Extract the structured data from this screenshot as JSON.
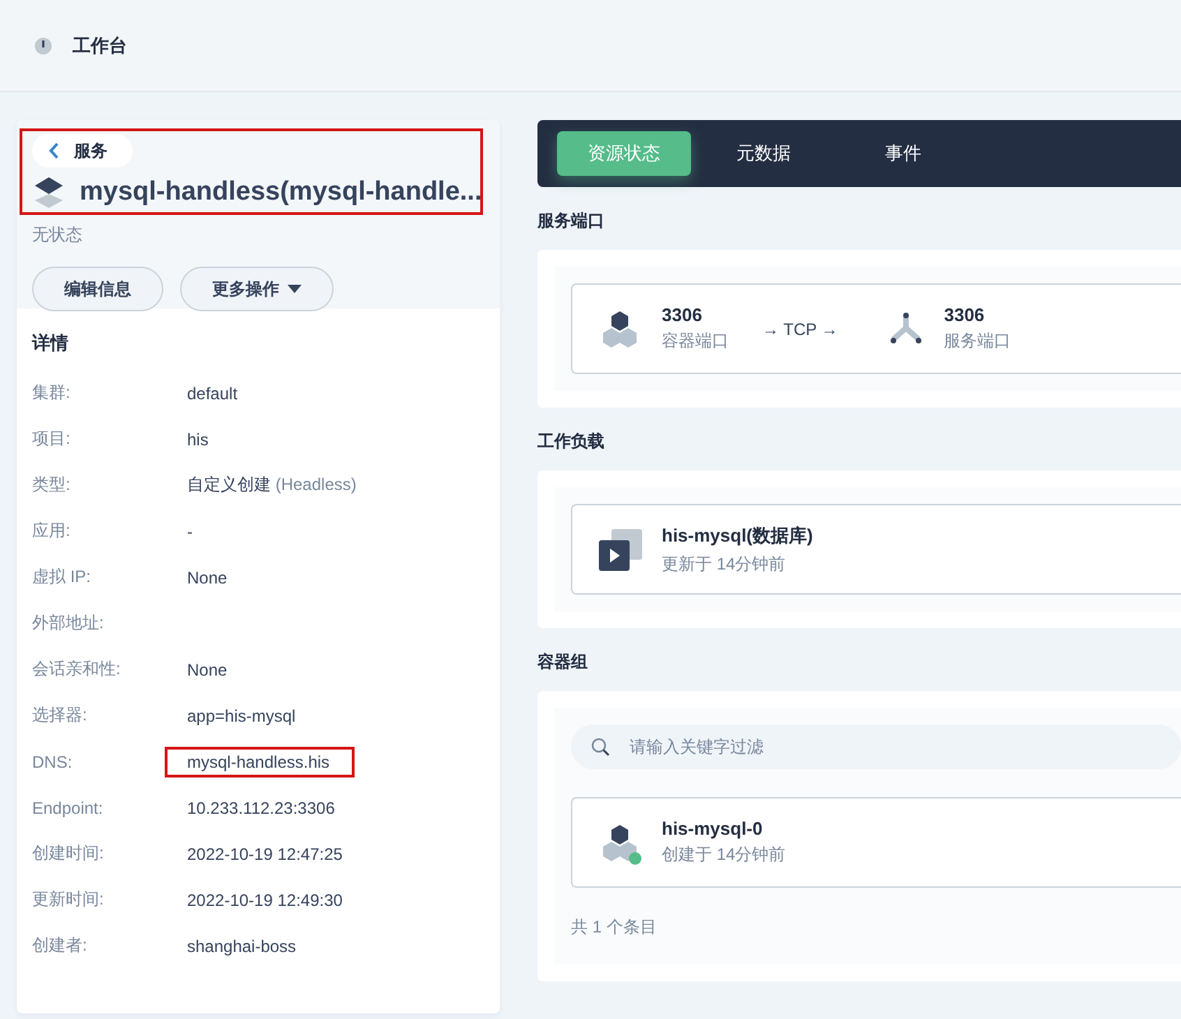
{
  "topbar": {
    "title": "工作台"
  },
  "service": {
    "back_label": "服务",
    "name": "mysql-handless(mysql-handle...",
    "status": "无状态",
    "highlighted": true,
    "buttons": [
      {
        "label": "编辑信息",
        "kind": "plain"
      },
      {
        "label": "更多操作",
        "kind": "dropdown"
      }
    ]
  },
  "details": {
    "title": "详情",
    "rows": [
      {
        "label": "集群:",
        "value": "default",
        "highlighted": false
      },
      {
        "label": "项目:",
        "value": "his",
        "highlighted": false
      },
      {
        "label": "类型:",
        "value": "自定义创建",
        "note": "(Headless)",
        "highlighted": false
      },
      {
        "label": "应用:",
        "value": "-",
        "highlighted": false
      },
      {
        "label": "虚拟 IP:",
        "value": "None",
        "highlighted": false
      },
      {
        "label": "外部地址:"
      },
      {
        "label": "会话亲和性:",
        "value": "None",
        "highlighted": false
      },
      {
        "label": "选择器:",
        "value": "app=his-mysql",
        "highlighted": false
      },
      {
        "label": "DNS:",
        "value": "mysql-handless.his",
        "highlighted": true
      },
      {
        "label": "Endpoint:",
        "value": "10.233.112.23:3306",
        "highlighted": false
      },
      {
        "label": "创建时间:",
        "value": "2022-10-19 12:47:25",
        "highlighted": false
      },
      {
        "label": "更新时间:",
        "value": "2022-10-19 12:49:30",
        "highlighted": false
      },
      {
        "label": "创建者:",
        "value": "shanghai-boss",
        "highlighted": false
      }
    ]
  },
  "tabs": [
    {
      "label": "资源状态",
      "selected": true
    },
    {
      "label": "元数据",
      "selected": false
    },
    {
      "label": "事件",
      "selected": false
    }
  ],
  "ports": {
    "title": "服务端口",
    "container_port": "3306",
    "container_label": "容器端口",
    "protocol": "→ TCP →",
    "service_port": "3306",
    "service_label": "服务端口"
  },
  "workloads": {
    "title": "工作负载",
    "items": [
      {
        "name": "his-mysql(数据库)",
        "meta": "更新于 14分钟前"
      }
    ]
  },
  "pods": {
    "title": "容器组",
    "search": {
      "placeholder": "请输入关键字过滤"
    },
    "items": [
      {
        "name": "his-mysql-0",
        "meta": "创建于 14分钟前",
        "color": "#55bc8a"
      }
    ],
    "total": "共 1 个条目"
  }
}
